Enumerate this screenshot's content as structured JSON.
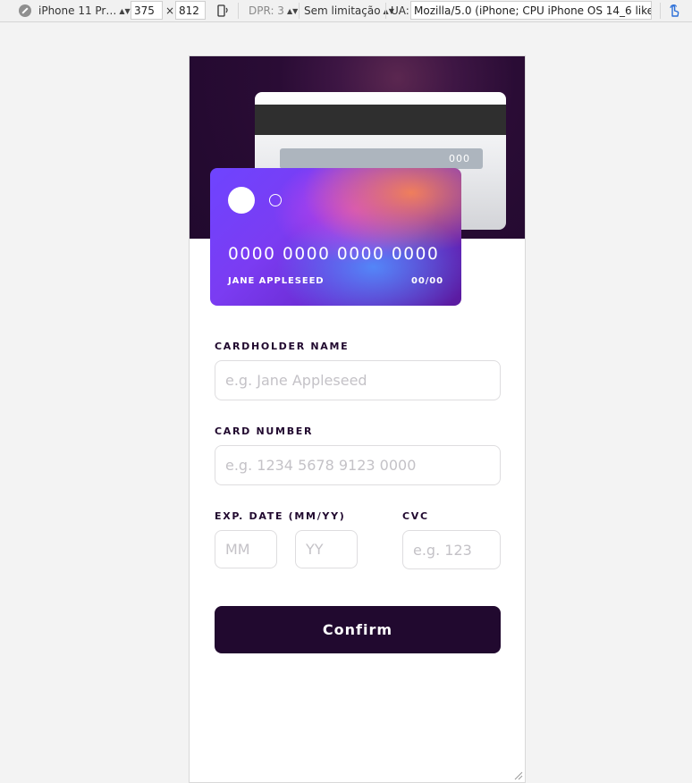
{
  "devtools": {
    "device": "iPhone 11 Pr…",
    "width": "375",
    "times": "×",
    "height": "812",
    "dpr": "DPR: 3",
    "throttle": "Sem limitação",
    "ua_label": "UA:",
    "ua_value": "Mozilla/5.0 (iPhone; CPU iPhone OS 14_6 like Mac"
  },
  "card": {
    "cvc": "000",
    "number": "0000 0000 0000 0000",
    "name": "JANE APPLESEED",
    "expiry": "00/00"
  },
  "form": {
    "name_label": "CARDHOLDER NAME",
    "name_placeholder": "e.g. Jane Appleseed",
    "number_label": "CARD NUMBER",
    "number_placeholder": "e.g. 1234 5678 9123 0000",
    "exp_label": "EXP. DATE (MM/YY)",
    "mm_placeholder": "MM",
    "yy_placeholder": "YY",
    "cvc_label": "CVC",
    "cvc_placeholder": "e.g. 123",
    "confirm_label": "Confirm"
  },
  "colors": {
    "primary_dark": "#21092f",
    "input_border": "#dedddf",
    "placeholder": "#c4c2c7"
  },
  "icons": [
    "device-icon",
    "rotate-icon",
    "touch-icon",
    "resize-grip-icon"
  ]
}
